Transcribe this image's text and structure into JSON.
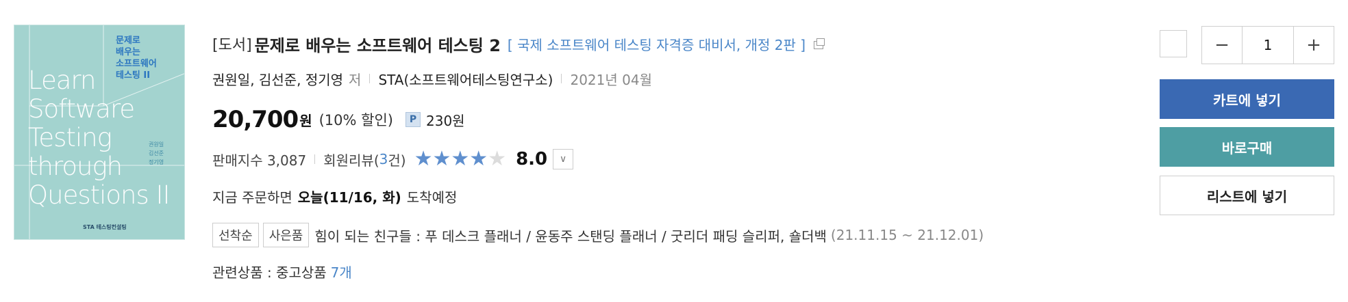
{
  "cover": {
    "kr_title_lines": [
      "문제로",
      "배우는",
      "소프트웨어",
      "테스팅 II"
    ],
    "en_title_lines": [
      "Learn",
      "Software",
      "Testing",
      "through",
      "Questions II"
    ],
    "authors": [
      "권원일",
      "김선준",
      "정기영"
    ],
    "publisher_mark": "STA 테스팅컨설팅",
    "bg_color": "#a3d3cf"
  },
  "product": {
    "category": "[도서]",
    "title": "문제로 배우는 소프트웨어 테스팅 2",
    "subtitle": "[ 국제 소프트웨어 테스팅 자격증 대비서, 개정 2판 ]",
    "authors": "권원일, 김선준, 정기영",
    "author_suffix": "저",
    "publisher": "STA(소프트웨어테스팅연구소)",
    "pub_date": "2021년 04월",
    "price": "20,700",
    "price_unit": "원",
    "discount": "(10% 할인)",
    "point_icon": "P",
    "point": "230원",
    "sales_label": "판매지수 3,087",
    "review_label": "회원리뷰(",
    "review_count": "3",
    "review_suffix": "건)",
    "rating_stars": 4,
    "rating_max": 5,
    "rating": "8.0",
    "delivery_prefix": "지금 주문하면",
    "delivery_date": "오늘(11/16, 화)",
    "delivery_suffix": "도착예정",
    "event_tags": [
      "선착순",
      "사은품"
    ],
    "event_text": "힘이 되는 친구들 : 푸 데스크 플래너 / 윤동주 스탠딩 플래너 / 굿리더 패딩 슬리퍼, 숄더백",
    "event_date": "(21.11.15 ~ 21.12.01)",
    "related_label": "관련상품 : 중고상품",
    "related_count": "7개"
  },
  "actions": {
    "qty_minus": "−",
    "qty_value": "1",
    "qty_plus": "+",
    "cart_label": "카트에 넣기",
    "buy_label": "바로구매",
    "list_label": "리스트에 넣기",
    "cart_color": "#3a69b3",
    "buy_color": "#4e9ea3"
  }
}
